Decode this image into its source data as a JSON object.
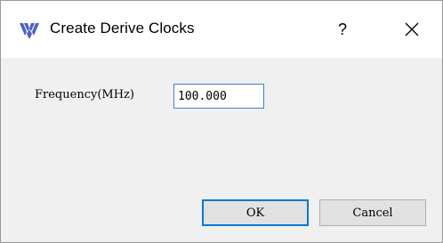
{
  "window": {
    "title": "Create Derive Clocks",
    "help_label": "?",
    "app_icon": "gowin-logo-icon",
    "help_icon": "help-icon",
    "close_icon": "close-icon"
  },
  "form": {
    "frequency_label": "Frequency(MHz)",
    "frequency_value": "100.000"
  },
  "buttons": {
    "ok_label": "OK",
    "cancel_label": "Cancel"
  },
  "colors": {
    "accent": "#0078d7",
    "input_border": "#3c7fd6",
    "logo": "#4a5fc8"
  }
}
